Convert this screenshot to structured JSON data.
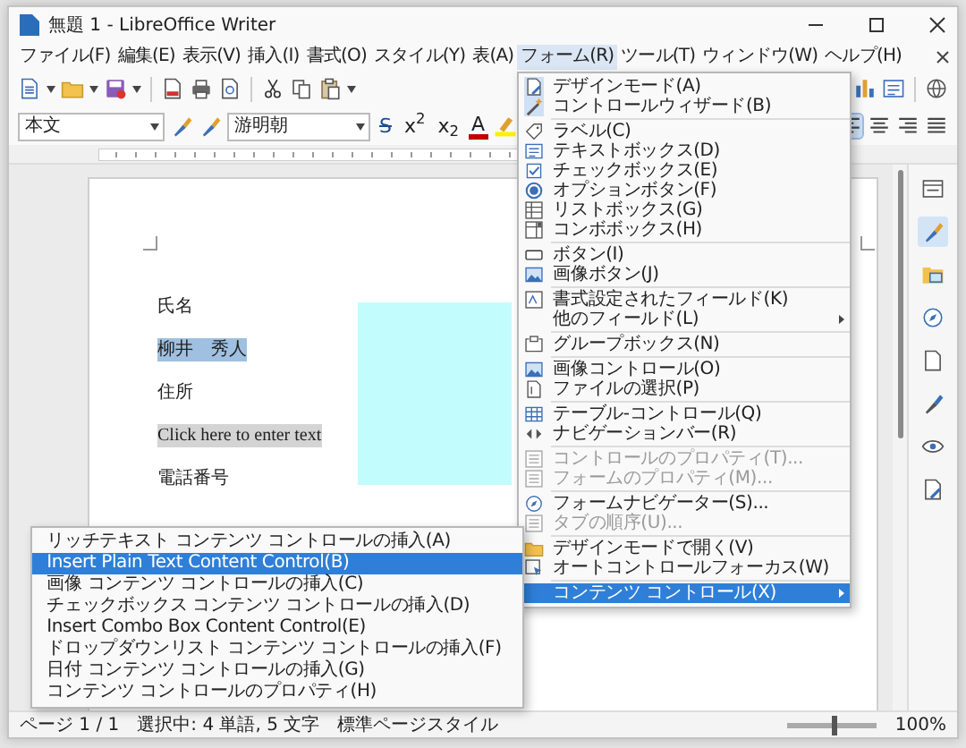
{
  "window": {
    "title": "無題 1 - LibreOffice Writer"
  },
  "menu_bar": [
    {
      "label": "ファイル(F)",
      "selected": false
    },
    {
      "label": "編集(E)",
      "selected": false
    },
    {
      "label": "表示(V)",
      "selected": false
    },
    {
      "label": "挿入(I)",
      "selected": false
    },
    {
      "label": "書式(O)",
      "selected": false
    },
    {
      "label": "スタイル(Y)",
      "selected": false
    },
    {
      "label": "表(A)",
      "selected": false
    },
    {
      "label": "フォーム(R)",
      "selected": true
    },
    {
      "label": "ツール(T)",
      "selected": false
    },
    {
      "label": "ウィンドウ(W)",
      "selected": false
    },
    {
      "label": "ヘルプ(H)",
      "selected": false
    }
  ],
  "formatting": {
    "paragraph_style": "本文",
    "font_name": "游明朝",
    "text_buttons": [
      {
        "kind": "strike",
        "label": "S"
      },
      {
        "kind": "script",
        "label": "x$^{2}$"
      },
      {
        "kind": "script",
        "label": "x$_{2}$"
      },
      {
        "kind": "color",
        "label": "A"
      }
    ],
    "alignment": [
      {
        "kind": "left",
        "selected": true
      },
      {
        "kind": "center",
        "selected": false
      },
      {
        "kind": "right",
        "selected": false
      },
      {
        "kind": "justify",
        "selected": false
      }
    ]
  },
  "document": {
    "lines": [
      {
        "text": "氏名",
        "kind": "plain"
      },
      {
        "text": "柳井　秀人",
        "kind": "selection"
      },
      {
        "text": "住所",
        "kind": "plain"
      },
      {
        "text": "Click here to enter text",
        "kind": "placeholder"
      },
      {
        "text": "電話番号",
        "kind": "plain"
      }
    ]
  },
  "sidebar": [
    {
      "kind": "properties",
      "selected": false
    },
    {
      "kind": "styles",
      "selected": true
    },
    {
      "kind": "gallery",
      "selected": false
    },
    {
      "kind": "navigator",
      "selected": false
    },
    {
      "kind": "page",
      "selected": false
    },
    {
      "kind": "inspector",
      "selected": false
    },
    {
      "kind": "changes",
      "selected": false
    },
    {
      "kind": "design",
      "selected": false
    }
  ],
  "form_menu": [
    {
      "kind": "design",
      "label": "デザインモード(A)",
      "checked": true,
      "disabled": false,
      "selected": false,
      "submenu": false
    },
    {
      "kind": "wizard",
      "label": "コントロールウィザード(B)",
      "checked": true,
      "disabled": false,
      "selected": false,
      "submenu": false
    },
    {
      "kind": "separator"
    },
    {
      "kind": "label",
      "label": "ラベル(C)",
      "checked": false,
      "disabled": false,
      "selected": false,
      "submenu": false
    },
    {
      "kind": "textbox",
      "label": "テキストボックス(D)",
      "checked": false,
      "disabled": false,
      "selected": false,
      "submenu": false
    },
    {
      "kind": "checkbox",
      "label": "チェックボックス(E)",
      "checked": false,
      "disabled": false,
      "selected": false,
      "submenu": false
    },
    {
      "kind": "radio",
      "label": "オプションボタン(F)",
      "checked": false,
      "disabled": false,
      "selected": false,
      "submenu": false
    },
    {
      "kind": "listbox",
      "label": "リストボックス(G)",
      "checked": false,
      "disabled": false,
      "selected": false,
      "submenu": false
    },
    {
      "kind": "combobox",
      "label": "コンボボックス(H)",
      "checked": false,
      "disabled": false,
      "selected": false,
      "submenu": false
    },
    {
      "kind": "separator"
    },
    {
      "kind": "button",
      "label": "ボタン(I)",
      "checked": false,
      "disabled": false,
      "selected": false,
      "submenu": false
    },
    {
      "kind": "image",
      "label": "画像ボタン(J)",
      "checked": false,
      "disabled": false,
      "selected": false,
      "submenu": false
    },
    {
      "kind": "separator"
    },
    {
      "kind": "formatted",
      "label": "書式設定されたフィールド(K)",
      "checked": false,
      "disabled": false,
      "selected": false,
      "submenu": false
    },
    {
      "kind": "plain",
      "label": "他のフィールド(L)",
      "checked": false,
      "disabled": false,
      "selected": false,
      "submenu": true
    },
    {
      "kind": "separator"
    },
    {
      "kind": "group",
      "label": "グループボックス(N)",
      "checked": false,
      "disabled": false,
      "selected": false,
      "submenu": false
    },
    {
      "kind": "separator"
    },
    {
      "kind": "image",
      "label": "画像コントロール(O)",
      "checked": false,
      "disabled": false,
      "selected": false,
      "submenu": false
    },
    {
      "kind": "file",
      "label": "ファイルの選択(P)",
      "checked": false,
      "disabled": false,
      "selected": false,
      "submenu": false
    },
    {
      "kind": "separator"
    },
    {
      "kind": "table",
      "label": "テーブル-コントロール(Q)",
      "checked": false,
      "disabled": false,
      "selected": false,
      "submenu": false
    },
    {
      "kind": "navbar",
      "label": "ナビゲーションバー(R)",
      "checked": false,
      "disabled": false,
      "selected": false,
      "submenu": false
    },
    {
      "kind": "separator"
    },
    {
      "kind": "props",
      "label": "コントロールのプロパティ(T)...",
      "checked": false,
      "disabled": true,
      "selected": false,
      "submenu": false
    },
    {
      "kind": "props",
      "label": "フォームのプロパティ(M)...",
      "checked": false,
      "disabled": true,
      "selected": false,
      "submenu": false
    },
    {
      "kind": "separator"
    },
    {
      "kind": "navigator",
      "label": "フォームナビゲーター(S)...",
      "checked": false,
      "disabled": false,
      "selected": false,
      "submenu": false
    },
    {
      "kind": "props",
      "label": "タブの順序(U)...",
      "checked": false,
      "disabled": true,
      "selected": false,
      "submenu": false
    },
    {
      "kind": "separator"
    },
    {
      "kind": "folder",
      "label": "デザインモードで開く(V)",
      "checked": false,
      "disabled": false,
      "selected": false,
      "submenu": false
    },
    {
      "kind": "focus",
      "label": "オートコントロールフォーカス(W)",
      "checked": false,
      "disabled": false,
      "selected": false,
      "submenu": false
    },
    {
      "kind": "separator"
    },
    {
      "kind": "plain",
      "label": "コンテンツ コントロール(X)",
      "checked": false,
      "disabled": false,
      "selected": true,
      "submenu": true
    }
  ],
  "content_control_menu": [
    {
      "label": "リッチテキスト コンテンツ コントロールの挿入(A)",
      "selected": false
    },
    {
      "label": "Insert Plain Text Content Control(B)",
      "selected": true
    },
    {
      "label": "画像 コンテンツ コントロールの挿入(C)",
      "selected": false
    },
    {
      "label": "チェックボックス コンテンツ コントロールの挿入(D)",
      "selected": false
    },
    {
      "label": "Insert Combo Box Content Control(E)",
      "selected": false
    },
    {
      "label": "ドロップダウンリスト コンテンツ コントロールの挿入(F)",
      "selected": false
    },
    {
      "label": "日付 コンテンツ コントロールの挿入(G)",
      "selected": false
    },
    {
      "label": "コンテンツ コントロールのプロパティ(H)",
      "selected": false
    }
  ],
  "status_bar": {
    "page": "ページ 1 / 1",
    "selection": "選択中: 4 単語, 5 文字",
    "page_style": "標準ページスタイル",
    "zoom": "100%",
    "zoom_slider": {
      "level": 0.5
    }
  }
}
